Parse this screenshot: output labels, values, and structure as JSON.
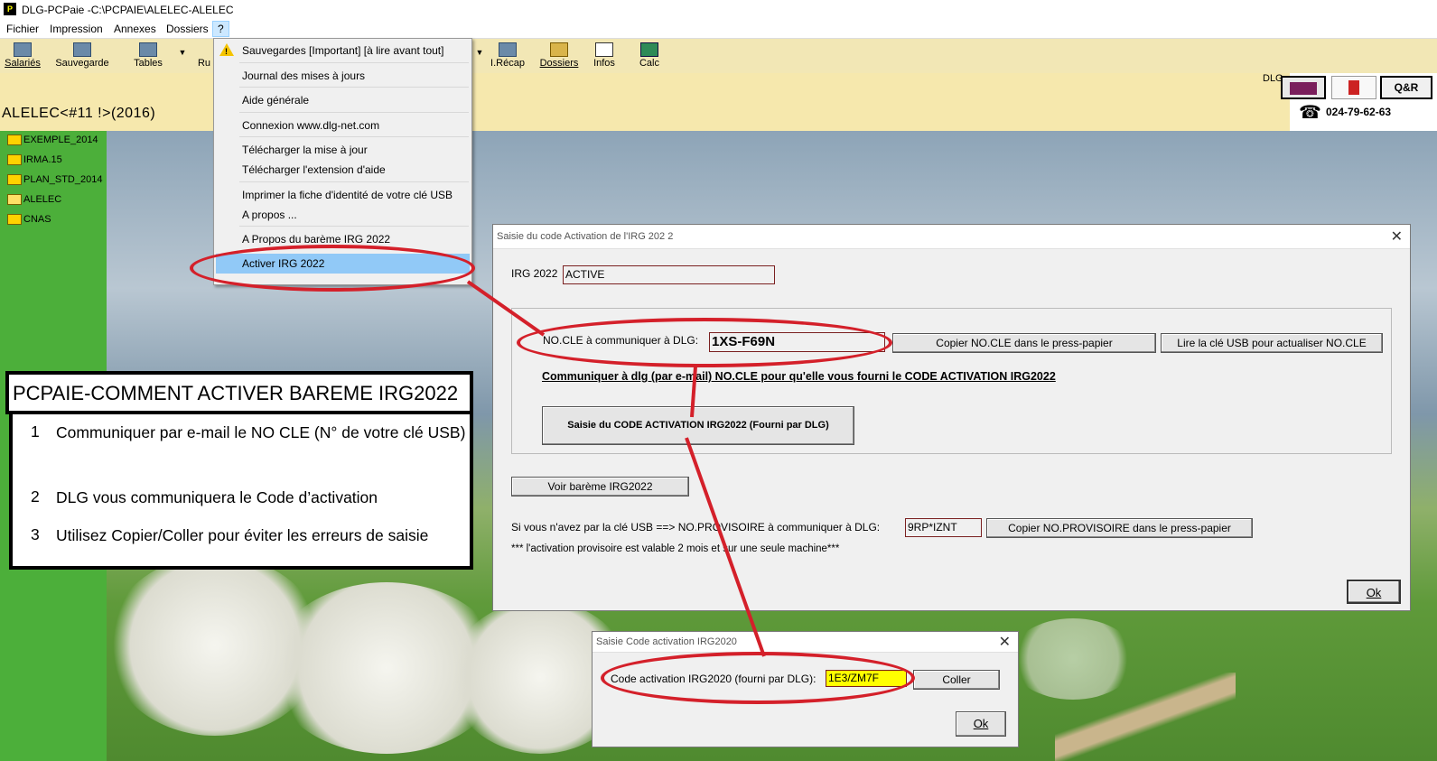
{
  "window": {
    "title": "DLG-PCPaie -C:\\PCPAIE\\ALELEC-ALELEC",
    "app_icon": "P"
  },
  "menubar": {
    "items": [
      "Fichier",
      "Impression",
      "Annexes",
      "Dossiers",
      "?"
    ]
  },
  "toolbar": {
    "items": [
      {
        "label": "Salariés",
        "icon": "people-icon"
      },
      {
        "label": "Sauvegarde",
        "icon": "save-icon"
      },
      {
        "label": "Tables",
        "icon": "tables-icon"
      },
      {
        "label": "Ru",
        "icon": "rubriques-icon"
      },
      {
        "label": "I.Récap",
        "icon": "recap-icon"
      },
      {
        "label": "Dossiers",
        "icon": "folder-open-icon"
      },
      {
        "label": "Infos",
        "icon": "infos-icon"
      },
      {
        "label": "Calc",
        "icon": "calculator-icon"
      }
    ]
  },
  "header": {
    "dossier": "ALELEC<#11 !>(2016)",
    "dlg_label": "DLG",
    "qr_label": "Q&R",
    "phone": "024-79-62-63"
  },
  "sidebar": {
    "folders": [
      "EXEMPLE_2014",
      "IRMA.15",
      "PLAN_STD_2014",
      "ALELEC",
      "CNAS"
    ]
  },
  "help_menu": {
    "items": [
      "Sauvegardes [Important] [à lire avant tout]",
      "Journal des mises à jours",
      "Aide générale",
      "Connexion www.dlg-net.com",
      "Télécharger la mise à jour",
      "Télécharger l'extension d'aide",
      "Imprimer la fiche d'identité de votre clé USB",
      "A propos ...",
      "A Propos du barème IRG 2022",
      "Activer IRG 2022"
    ]
  },
  "dialog_irg": {
    "title": "Saisie du code Activation de l'IRG 202 2",
    "irg_label": "IRG 2022",
    "irg_value": "ACTIVE",
    "nocle_label": "NO.CLE à communiquer à DLG:",
    "nocle_value": "1XS-F69N",
    "copy_nocle_btn": "Copier NO.CLE dans le press-papier",
    "read_usb_btn": "Lire la clé USB pour actualiser NO.CLE",
    "instruction_link": "Communiquer à dlg (par e-mail)  NO.CLE pour qu'elle vous fourni le CODE ACTIVATION IRG2022",
    "enter_code_btn": "Saisie du CODE ACTIVATION IRG2022 (Fourni par DLG)",
    "view_bareme_btn": "Voir barème IRG2022",
    "provisoire_label": "Si vous n'avez par la clé USB ==> NO.PROVISOIRE à communiquer à DLG:",
    "provisoire_value": "9RP*IZNT",
    "copy_provisoire_btn": "Copier NO.PROVISOIRE dans le press-papier",
    "note": "*** l'activation provisoire est valable 2 mois et sur une seule machine***",
    "ok_btn": "Ok"
  },
  "dialog_code": {
    "title": "Saisie Code activation IRG2020",
    "label": "Code activation IRG2020 (fourni par DLG):",
    "value": "1E3/ZM7F",
    "paste_btn": "Coller",
    "ok_btn": "Ok"
  },
  "instructions": {
    "title": "PCPAIE-COMMENT ACTIVER BAREME IRG2022",
    "steps": [
      {
        "n": "1",
        "text": "Communiquer par e-mail  le NO CLE  (N° de votre clé USB)"
      },
      {
        "n": "2",
        "text": "DLG vous communiquera  le Code d’activation"
      },
      {
        "n": "3",
        "text": "Utilisez  Copier/Coller pour éviter les erreurs de saisie"
      }
    ]
  },
  "colors": {
    "toolbar_bg": "#f2e7b5",
    "sidebar_bg": "#4caf3a",
    "annotation_red": "#d4202a",
    "code_field_bg": "#ffff00",
    "menu_highlight": "#91c9f7"
  }
}
